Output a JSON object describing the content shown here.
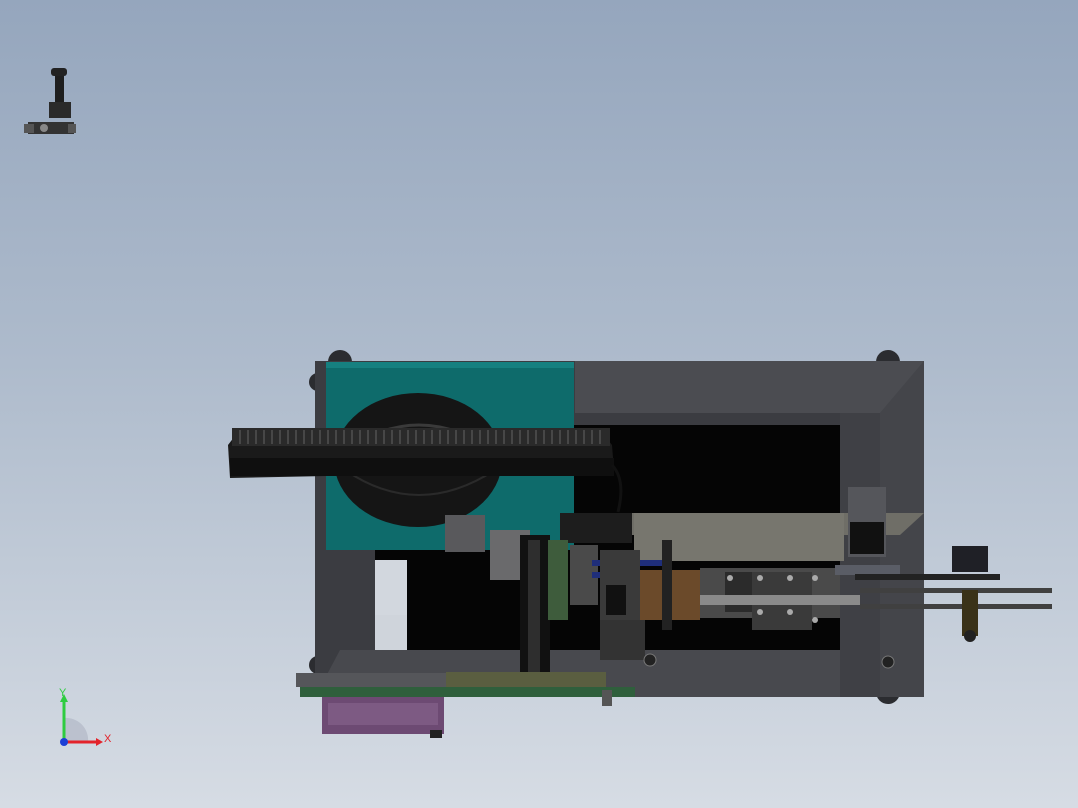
{
  "viewport": {
    "background_top": "#95a6bd",
    "background_bottom": "#d6dce4"
  },
  "triad": {
    "x_label": "X",
    "y_label": "Y",
    "x_color": "#e3232b",
    "y_color": "#2ecc40",
    "z_color": "#1c3fd6"
  },
  "icons": {
    "orientation_icon": "standard-views-figure-icon"
  },
  "model": {
    "frame_color": "#3b3c41",
    "panel_teal": "#0e6b6b",
    "base_purple": "#6d4a73",
    "board_green": "#2f5f3c"
  }
}
